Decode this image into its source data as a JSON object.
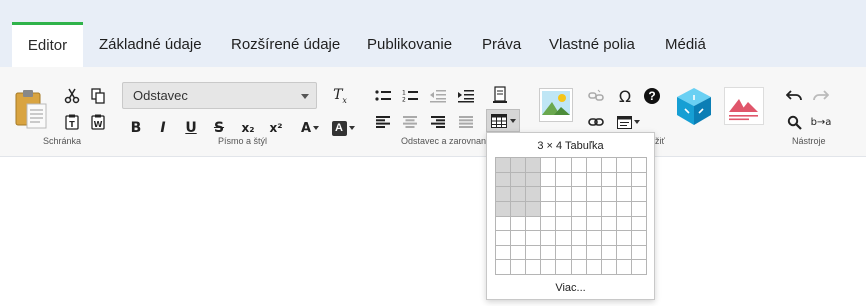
{
  "tabs": [
    {
      "label": "Editor",
      "active": true
    },
    {
      "label": "Základné údaje"
    },
    {
      "label": "Rozšírené údaje"
    },
    {
      "label": "Publikovanie"
    },
    {
      "label": "Práva"
    },
    {
      "label": "Vlastné polia"
    },
    {
      "label": "Médiá"
    }
  ],
  "groups": {
    "clipboard": "Schránka",
    "font": "Písmo a štýl",
    "paragraph": "Odstavec a zarovnan",
    "insert_tail": "žiť",
    "tools": "Nástroje"
  },
  "format_select": {
    "value": "Odstavec"
  },
  "font_buttons": {
    "bold": "B",
    "italic": "I",
    "underline": "U",
    "strike": "S",
    "subscript": "x₂",
    "superscript": "x²",
    "font_color": "A",
    "bg_color": "A"
  },
  "insert": {
    "omega": "Ω",
    "help": "?"
  },
  "tools": {
    "replace": "b→a"
  },
  "table_popup": {
    "title": "3 × 4 Tabuľka",
    "more": "Viac...",
    "rows": 8,
    "cols": 10,
    "selected_rows": 4,
    "selected_cols": 3
  },
  "colors": {
    "accent": "#2fb34a",
    "tabbar": "#e8eef7",
    "selected_cell": "#d5d5d5"
  }
}
